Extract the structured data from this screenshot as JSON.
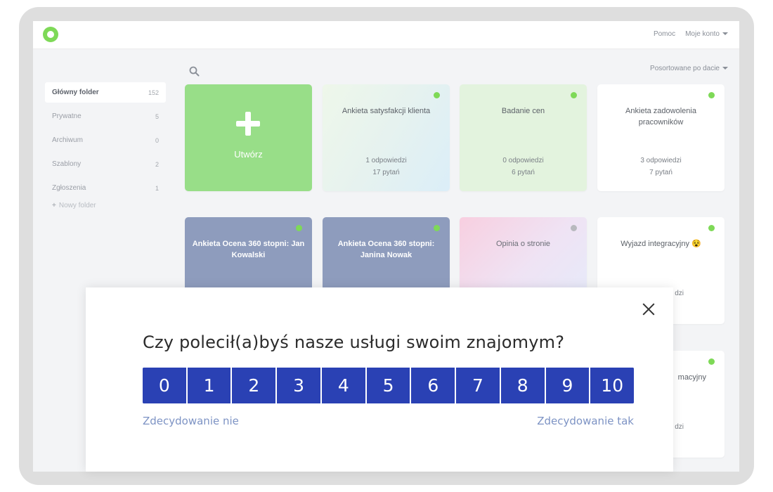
{
  "topbar": {
    "help": "Pomoc",
    "account": "Moje konto"
  },
  "sidebar": {
    "items": [
      {
        "label": "Główny folder",
        "count": "152"
      },
      {
        "label": "Prywatne",
        "count": "5"
      },
      {
        "label": "Archiwum",
        "count": "0"
      },
      {
        "label": "Szablony",
        "count": "2"
      },
      {
        "label": "Zgłoszenia",
        "count": "1"
      }
    ],
    "new_folder": "Nowy folder"
  },
  "sort": {
    "label": "Posortowane po dacie"
  },
  "cards": {
    "create": "Utwórz",
    "c1": {
      "title": "Ankieta satysfakcji klienta",
      "responses": "1 odpowiedzi",
      "questions": "17 pytań"
    },
    "c2": {
      "title": "Badanie cen",
      "responses": "0 odpowiedzi",
      "questions": "6 pytań"
    },
    "c3": {
      "title": "Ankieta zadowolenia pracowników",
      "responses": "3 odpowiedzi",
      "questions": "7 pytań"
    },
    "c4": {
      "title": "Ankieta Ocena 360 stopni: Jan Kowalski"
    },
    "c5": {
      "title": "Ankieta Ocena 360 stopni: Janina Nowak"
    },
    "c6": {
      "title": "Opinia o stronie"
    },
    "c7": {
      "title": "Wyjazd integracyjny 😵",
      "responses_partial": "dzi"
    },
    "c8": {
      "title_partial": "macyjny",
      "responses_partial": "dzi"
    }
  },
  "modal": {
    "question": "Czy polecił(a)byś nasze usługi swoim znajomym?",
    "scale": [
      "0",
      "1",
      "2",
      "3",
      "4",
      "5",
      "6",
      "7",
      "8",
      "9",
      "10"
    ],
    "low_label": "Zdecydowanie nie",
    "high_label": "Zdecydowanie tak"
  },
  "colors": {
    "accent": "#2a41b4",
    "brand_green": "#7ed957",
    "create_card": "#98de88",
    "slate_card": "#8e9cbd"
  }
}
